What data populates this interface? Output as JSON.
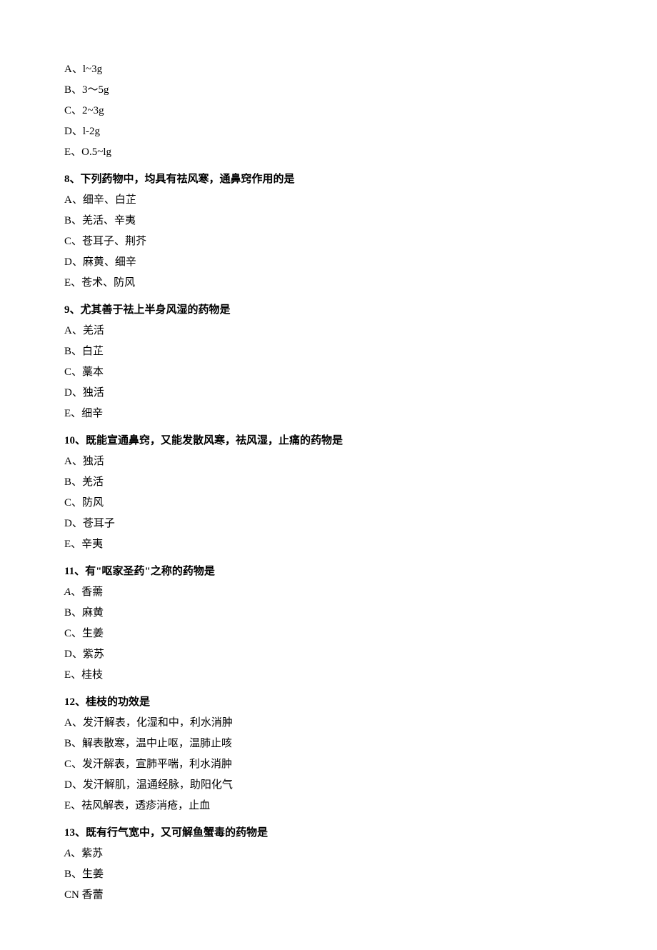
{
  "items": [
    {
      "type": "option",
      "text": "A、l~3g"
    },
    {
      "type": "option",
      "text": "B、3～5g"
    },
    {
      "type": "option",
      "text": "C、2~3g"
    },
    {
      "type": "option",
      "text": "D、l-2g"
    },
    {
      "type": "option",
      "text": "E、O.5~lg"
    },
    {
      "type": "question",
      "text": "8、下列药物中，均具有祛风寒，通鼻窍作用的是"
    },
    {
      "type": "option",
      "text": "A、细辛、白芷"
    },
    {
      "type": "option",
      "text": "B、羌活、辛夷"
    },
    {
      "type": "option",
      "text": "C、苍耳子、荆芥"
    },
    {
      "type": "option",
      "text": "D、麻黄、细辛"
    },
    {
      "type": "option",
      "text": "E、苍术、防风"
    },
    {
      "type": "question",
      "text": "9、尤其善于祛上半身风湿的药物是"
    },
    {
      "type": "option",
      "text": "A、羌活"
    },
    {
      "type": "option",
      "text": "B、白芷"
    },
    {
      "type": "option",
      "text": "C、藁本"
    },
    {
      "type": "option",
      "text": "D、独活"
    },
    {
      "type": "option",
      "text": "E、细辛"
    },
    {
      "type": "question",
      "text": "10、既能宣通鼻窍，又能发散风寒，祛风湿，止痛的药物是"
    },
    {
      "type": "option",
      "text": "A、独活"
    },
    {
      "type": "option",
      "text": "B、羌活"
    },
    {
      "type": "option",
      "text": "C、防风"
    },
    {
      "type": "option",
      "text": "D、苍耳子"
    },
    {
      "type": "option",
      "text": "E、辛夷"
    },
    {
      "type": "question",
      "text": "11、有\"呕家圣药\"之称的药物是"
    },
    {
      "type": "option",
      "italic_prefix": "A",
      "text": "、香薷"
    },
    {
      "type": "option",
      "text": "B、麻黄"
    },
    {
      "type": "option",
      "text": "C、生姜"
    },
    {
      "type": "option",
      "text": "D、紫苏"
    },
    {
      "type": "option",
      "text": "E、桂枝"
    },
    {
      "type": "question",
      "text": "12、桂枝的功效是"
    },
    {
      "type": "option",
      "text": "A、发汗解表，化湿和中，利水消肿"
    },
    {
      "type": "option",
      "text": "B、解表散寒，温中止呕，温肺止咳"
    },
    {
      "type": "option",
      "text": "C、发汗解表，宣肺平喘，利水消肿"
    },
    {
      "type": "option",
      "text": "D、发汗解肌，温通经脉，助阳化气"
    },
    {
      "type": "option",
      "text": "E、祛风解表，透疹消疮，止血"
    },
    {
      "type": "question",
      "text": "13、既有行气宽中，又可解鱼蟹毒的药物是"
    },
    {
      "type": "option",
      "italic_prefix": "A",
      "text": "、紫苏"
    },
    {
      "type": "option",
      "text": "B、生姜"
    },
    {
      "type": "option",
      "text": "CN 香蕾"
    }
  ]
}
